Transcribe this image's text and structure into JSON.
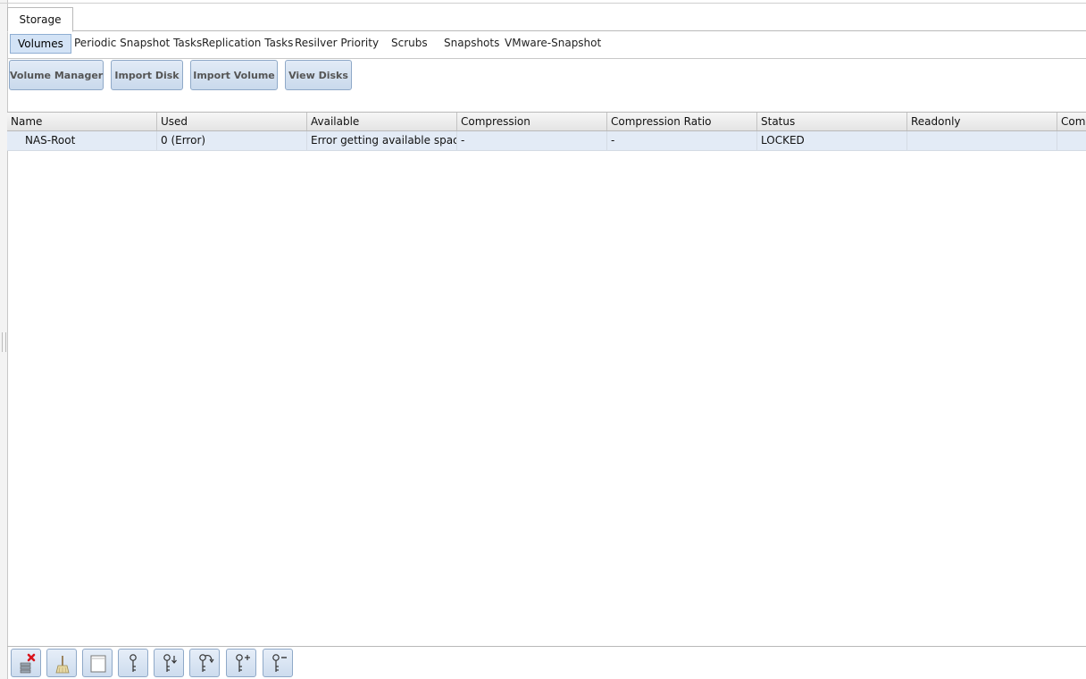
{
  "top_tab": {
    "label": "Storage"
  },
  "subtabs": [
    {
      "label": "Volumes",
      "active": true
    },
    {
      "label": "Periodic Snapshot Tasks"
    },
    {
      "label": "Replication Tasks"
    },
    {
      "label": "Resilver Priority"
    },
    {
      "label": "Scrubs"
    },
    {
      "label": "Snapshots"
    },
    {
      "label": "VMware-Snapshot"
    }
  ],
  "actions": {
    "volume_manager": "Volume Manager",
    "import_disk": "Import Disk",
    "import_volume": "Import Volume",
    "view_disks": "View Disks"
  },
  "grid": {
    "columns": [
      "Name",
      "Used",
      "Available",
      "Compression",
      "Compression Ratio",
      "Status",
      "Readonly",
      "Comm"
    ],
    "rows": [
      {
        "name": "NAS-Root",
        "used": "0 (Error)",
        "available": "Error getting available space",
        "compression": "-",
        "compression_ratio": "-",
        "status": "LOCKED",
        "readonly": "",
        "comments": ""
      }
    ]
  },
  "toolbar_icons": [
    "detach-volume-icon",
    "scrub-volume-icon",
    "volume-status-icon",
    "encryption-key-icon",
    "download-key-icon",
    "change-passphrase-icon",
    "add-recovery-key-icon",
    "remove-recovery-key-icon"
  ],
  "colors": {
    "accent": "#d3e3f6",
    "button_border": "#8fa9c8",
    "selected_row": "#e3ebf6",
    "error_mark": "#d9141c"
  }
}
